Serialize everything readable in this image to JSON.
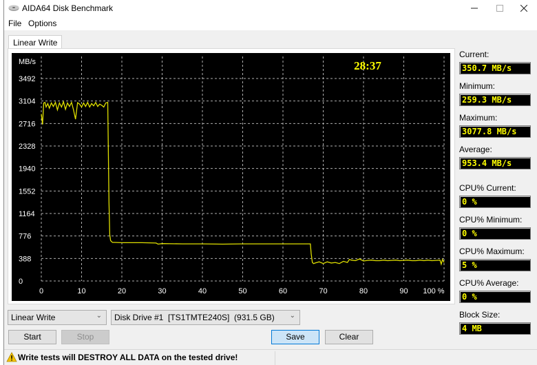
{
  "window": {
    "title": "AIDA64 Disk Benchmark",
    "icon": "disk-drive-icon",
    "controls": [
      "minimize-icon",
      "maximize-icon",
      "close-icon"
    ]
  },
  "menu": {
    "items": [
      "File",
      "Options"
    ]
  },
  "tabs": [
    {
      "label": "Linear Write",
      "active": true
    }
  ],
  "timer": "28:37",
  "stats": {
    "current_label": "Current:",
    "current_value": "350.7 MB/s",
    "minimum_label": "Minimum:",
    "minimum_value": "259.3 MB/s",
    "maximum_label": "Maximum:",
    "maximum_value": "3077.8 MB/s",
    "average_label": "Average:",
    "average_value": "953.4 MB/s",
    "cpu_current_label": "CPU% Current:",
    "cpu_current_value": "0 %",
    "cpu_minimum_label": "CPU% Minimum:",
    "cpu_minimum_value": "0 %",
    "cpu_maximum_label": "CPU% Maximum:",
    "cpu_maximum_value": "5 %",
    "cpu_average_label": "CPU% Average:",
    "cpu_average_value": "0 %",
    "block_size_label": "Block Size:",
    "block_size_value": "4 MB"
  },
  "controls": {
    "test_select": "Linear Write",
    "drive_select": "Disk Drive #1  [TS1TMTE240S]  (931.5 GB)",
    "start_label": "Start",
    "stop_label": "Stop",
    "save_label": "Save",
    "clear_label": "Clear"
  },
  "status": {
    "warning_icon": "warning-icon",
    "warning_text": "Write tests will DESTROY ALL DATA on the tested drive!"
  },
  "colors": {
    "chart_bg": "#000000",
    "line": "#e0e000",
    "value_text": "#ffff00",
    "grid": "#b0b0b0"
  },
  "chart_data": {
    "type": "line",
    "title": "",
    "xlabel": "",
    "ylabel": "MB/s",
    "x_suffix": "%",
    "xlim": [
      0,
      100
    ],
    "ylim": [
      0,
      3492
    ],
    "x_ticks": [
      0,
      10,
      20,
      30,
      40,
      50,
      60,
      70,
      80,
      90,
      100
    ],
    "x_tick_labels": [
      "0",
      "10",
      "20",
      "30",
      "40",
      "50",
      "60",
      "70",
      "80",
      "90",
      "100 %"
    ],
    "y_ticks": [
      0,
      388,
      776,
      1164,
      1552,
      1940,
      2328,
      2716,
      3104,
      3492
    ],
    "y_tick_labels": [
      "0",
      "388",
      "776",
      "1164",
      "1552",
      "1940",
      "2328",
      "2716",
      "3104",
      "3492"
    ],
    "grid": true,
    "series": [
      {
        "name": "Linear Write",
        "x": [
          0,
          0.3,
          0.6,
          0.9,
          1.2,
          1.6,
          2.0,
          2.5,
          3.0,
          3.5,
          4.0,
          4.5,
          5.0,
          5.5,
          6.0,
          6.5,
          7.0,
          7.5,
          8.0,
          8.5,
          9.0,
          9.5,
          10.0,
          10.5,
          11.0,
          11.5,
          12.0,
          12.5,
          13.0,
          13.5,
          14.0,
          14.5,
          15.0,
          15.5,
          16.0,
          16.5,
          16.8,
          17.0,
          17.2,
          17.4,
          17.7,
          18.2,
          20,
          25,
          28.5,
          29,
          30,
          35,
          40,
          45,
          50,
          55,
          60,
          65,
          66.8,
          67.0,
          67.3,
          67.6,
          68.0,
          69,
          70,
          71,
          72,
          73,
          74,
          75,
          76,
          76.5,
          77,
          78,
          79,
          80,
          81,
          82,
          83,
          84,
          85,
          86,
          87,
          88,
          89,
          90,
          91,
          92,
          93,
          94,
          95,
          96,
          97,
          98,
          99,
          99.3,
          99.6,
          100
        ],
        "y": [
          2880,
          2700,
          3070,
          3080,
          3000,
          3060,
          2980,
          3070,
          3010,
          3080,
          2950,
          3070,
          3000,
          3090,
          2960,
          3070,
          3010,
          3080,
          2950,
          2790,
          3075,
          3050,
          3000,
          3070,
          3010,
          3080,
          3000,
          3060,
          3020,
          3080,
          3010,
          3050,
          3030,
          3000,
          3070,
          3080,
          1360,
          800,
          700,
          680,
          665,
          665,
          660,
          660,
          655,
          635,
          645,
          640,
          640,
          635,
          640,
          640,
          640,
          640,
          640,
          470,
          320,
          300,
          310,
          330,
          300,
          330,
          310,
          320,
          300,
          340,
          320,
          370,
          360,
          350,
          380,
          345,
          355,
          360,
          350,
          350,
          360,
          350,
          355,
          360,
          350,
          355,
          360,
          350,
          350,
          360,
          350,
          360,
          350,
          355,
          360,
          290,
          370,
          320
        ]
      }
    ]
  }
}
